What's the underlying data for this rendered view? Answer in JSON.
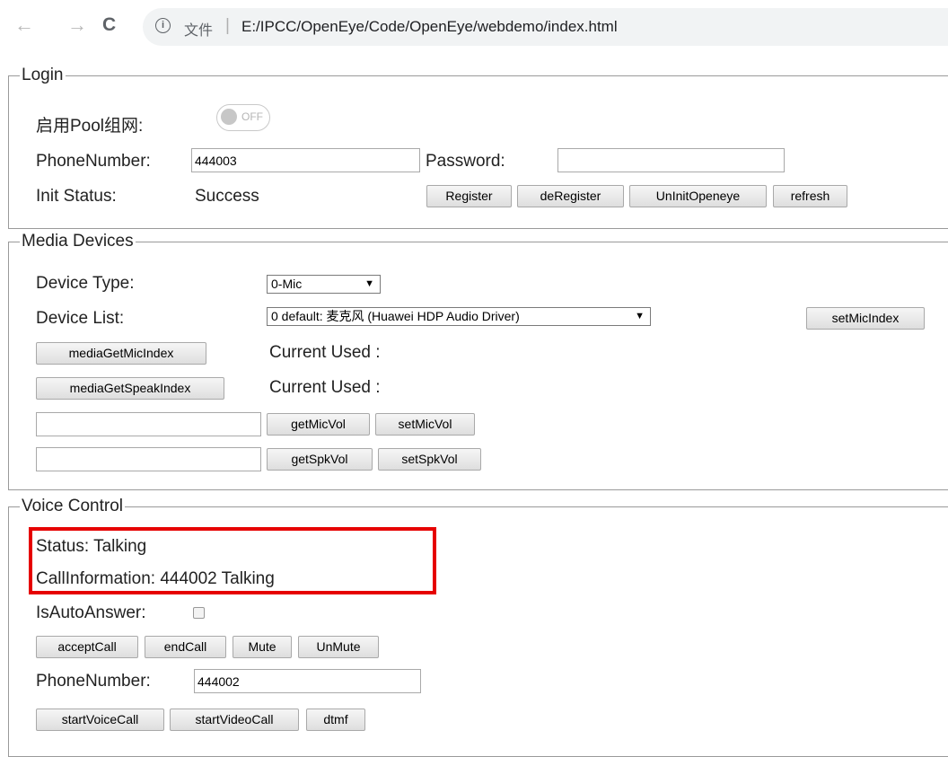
{
  "browser": {
    "back": "←",
    "forward": "→",
    "reload": "C",
    "info": "i",
    "label": "文件",
    "separator": "|",
    "url": "E:/IPCC/OpenEye/Code/OpenEye/webdemo/index.html"
  },
  "login": {
    "legend": "Login",
    "pool_label": "启用Pool组网:",
    "pool_toggle": "OFF",
    "phone_label": "PhoneNumber:",
    "phone_value": "444003",
    "password_label": "Password:",
    "password_value": "",
    "status_label": "Init Status:",
    "status_value": "Success",
    "buttons": [
      "Register",
      "deRegister",
      "UnInitOpeneye",
      "refresh"
    ]
  },
  "media": {
    "legend": "Media Devices",
    "type_label": "Device Type:",
    "type_value": "0-Mic",
    "list_label": "Device List:",
    "list_value": "0  default: 麦克风 (Huawei HDP Audio Driver)",
    "set_mic_index": "setMicIndex",
    "get_mic_index": "mediaGetMicIndex",
    "mic_current": "Current Used :",
    "get_speak_index": "mediaGetSpeakIndex",
    "speak_current": "Current Used :",
    "mic_vol_value": "",
    "get_mic_vol": "getMicVol",
    "set_mic_vol": "setMicVol",
    "spk_vol_value": "",
    "get_spk_vol": "getSpkVol",
    "set_spk_vol": "setSpkVol"
  },
  "voice": {
    "legend": "Voice Control",
    "status": "Status: Talking",
    "call_info": "CallInformation: 444002 Talking",
    "auto_answer_label": "IsAutoAnswer:",
    "auto_answer_checked": false,
    "buttons": [
      "acceptCall",
      "endCall",
      "Mute",
      "UnMute"
    ],
    "phone_label": "PhoneNumber:",
    "phone_value": "444002",
    "call_buttons": [
      "startVoiceCall",
      "startVideoCall",
      "dtmf"
    ]
  },
  "colors": {
    "highlight_border": "#e60000",
    "omnibox_bg": "#f1f3f4"
  },
  "icons": {
    "back": "arrow-left-icon",
    "forward": "arrow-right-icon",
    "reload": "reload-icon",
    "info": "info-circle-icon",
    "select": "dropdown-arrow-icon"
  }
}
